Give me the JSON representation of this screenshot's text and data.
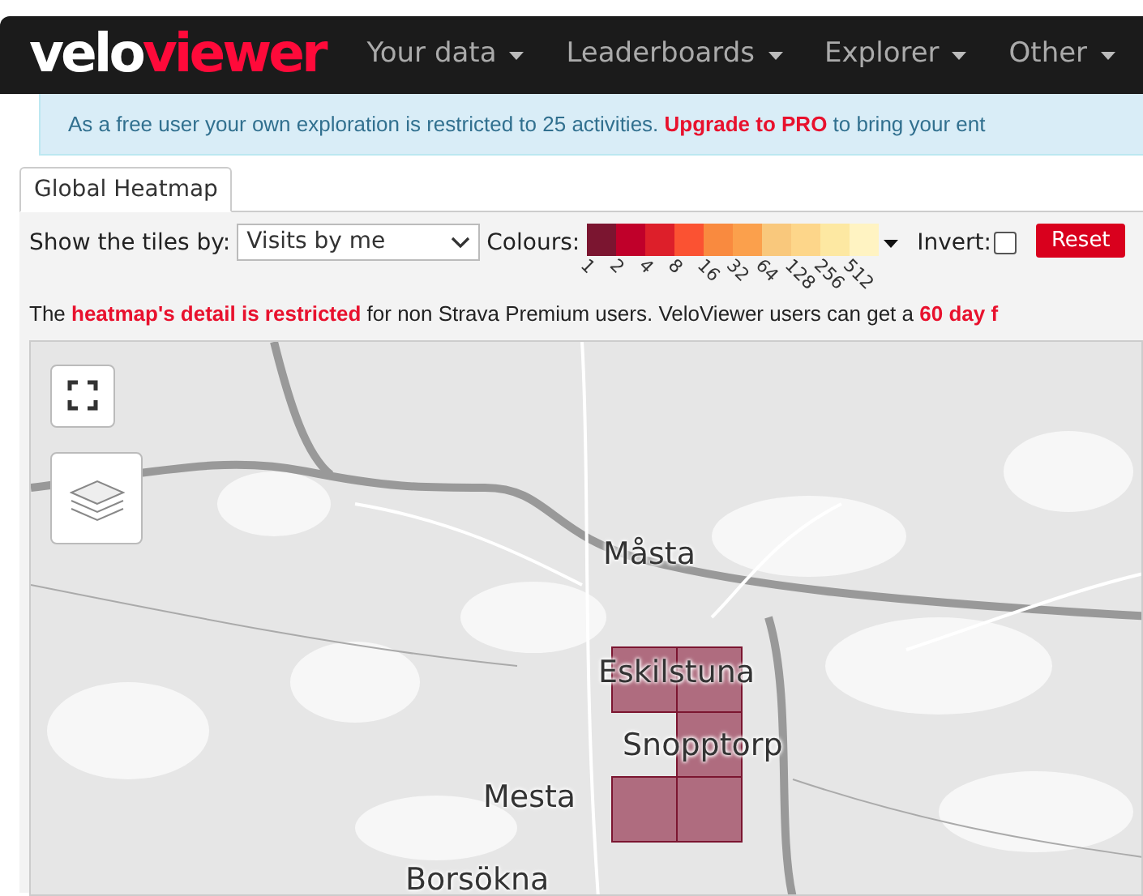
{
  "navbar": {
    "logo": {
      "part_1": "velo",
      "part_2": "viewer"
    },
    "menus": [
      {
        "label": "Your data"
      },
      {
        "label": "Leaderboards"
      },
      {
        "label": "Explorer"
      },
      {
        "label": "Other"
      }
    ]
  },
  "notice": {
    "text": "As a free user your own exploration is restricted to 25 activities. **Upgrade to PRO** to bring your ent"
  },
  "tabs": [
    {
      "label": "Global Heatmap",
      "selected": true
    }
  ],
  "controls": {
    "show_label": "Show the tiles by:",
    "show_value": "Visits by me",
    "colours_label": "Colours:",
    "scale": [
      {
        "label": "1",
        "color": "#7b1530"
      },
      {
        "label": "2",
        "color": "#c0002a"
      },
      {
        "label": "4",
        "color": "#dd1f2a"
      },
      {
        "label": "8",
        "color": "#fb5232"
      },
      {
        "label": "16",
        "color": "#f98a3f"
      },
      {
        "label": "32",
        "color": "#fba04c"
      },
      {
        "label": "64",
        "color": "#f9c87c"
      },
      {
        "label": "128",
        "color": "#fdd68a"
      },
      {
        "label": "256",
        "color": "#fde8a2"
      },
      {
        "label": "512",
        "color": "#fff3c2"
      }
    ],
    "invert_label": "Invert:",
    "invert_checked": false,
    "reset": "Reset"
  },
  "restriction": {
    "text": "The **heatmap's detail is restricted** for non Strava Premium users. VeloViewer users can get a **60 day f**"
  },
  "map": {
    "places": [
      {
        "name": "Måsta"
      },
      {
        "name": "Eskilstuna"
      },
      {
        "name": "Snopptorp"
      },
      {
        "name": "Mesta"
      },
      {
        "name": "Borsökna"
      }
    ]
  }
}
